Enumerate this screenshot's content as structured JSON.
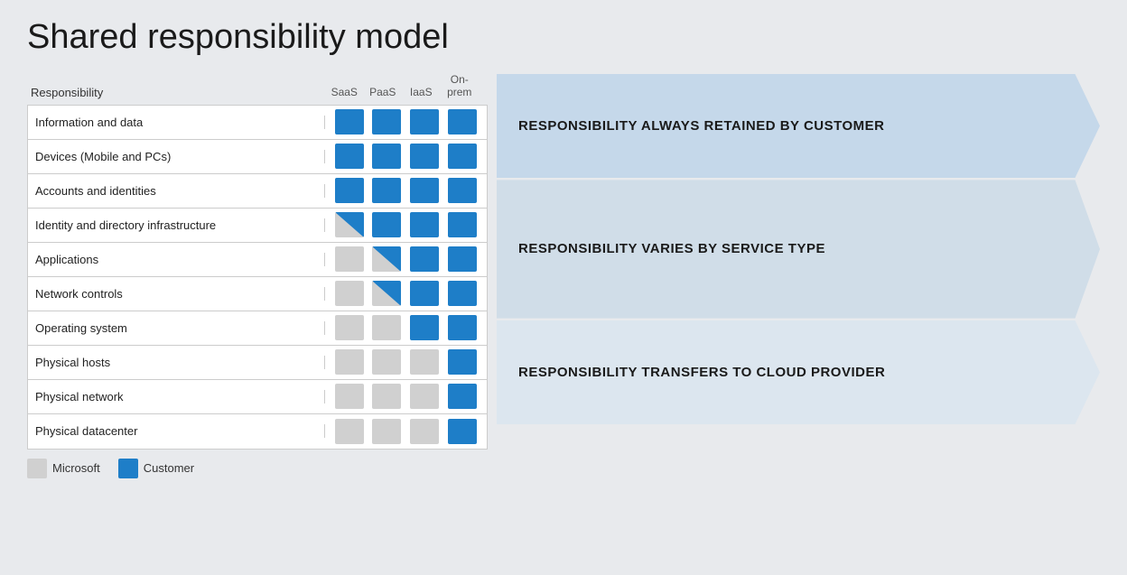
{
  "title": "Shared responsibility model",
  "columns": {
    "responsibility": "Responsibility",
    "saas": "SaaS",
    "paas": "PaaS",
    "iaas": "IaaS",
    "onprem": "On-prem"
  },
  "rows": [
    {
      "label": "Information and data",
      "saas": "blue",
      "paas": "blue",
      "iaas": "blue",
      "onprem": "blue"
    },
    {
      "label": "Devices (Mobile and PCs)",
      "saas": "blue",
      "paas": "blue",
      "iaas": "blue",
      "onprem": "blue"
    },
    {
      "label": "Accounts and identities",
      "saas": "blue",
      "paas": "blue",
      "iaas": "blue",
      "onprem": "blue"
    },
    {
      "label": "Identity and directory infrastructure",
      "saas": "half-blue",
      "paas": "blue",
      "iaas": "blue",
      "onprem": "blue"
    },
    {
      "label": "Applications",
      "saas": "gray",
      "paas": "half-blue",
      "iaas": "blue",
      "onprem": "blue"
    },
    {
      "label": "Network controls",
      "saas": "gray",
      "paas": "half-blue",
      "iaas": "blue",
      "onprem": "blue"
    },
    {
      "label": "Operating system",
      "saas": "gray",
      "paas": "gray",
      "iaas": "blue",
      "onprem": "blue"
    },
    {
      "label": "Physical hosts",
      "saas": "gray",
      "paas": "gray",
      "iaas": "gray",
      "onprem": "blue"
    },
    {
      "label": "Physical network",
      "saas": "gray",
      "paas": "gray",
      "iaas": "gray",
      "onprem": "blue"
    },
    {
      "label": "Physical datacenter",
      "saas": "gray",
      "paas": "gray",
      "iaas": "gray",
      "onprem": "blue"
    }
  ],
  "arrows": [
    {
      "text": "RESPONSIBILITY ALWAYS RETAINED BY CUSTOMER",
      "rows": 3,
      "color": "#c5d8ea"
    },
    {
      "text": "RESPONSIBILITY VARIES BY SERVICE TYPE",
      "rows": 4,
      "color": "#d0dde8"
    },
    {
      "text": "RESPONSIBILITY TRANSFERS TO CLOUD PROVIDER",
      "rows": 3,
      "color": "#dce6ef"
    }
  ],
  "legend": {
    "microsoft_label": "Microsoft",
    "customer_label": "Customer"
  }
}
